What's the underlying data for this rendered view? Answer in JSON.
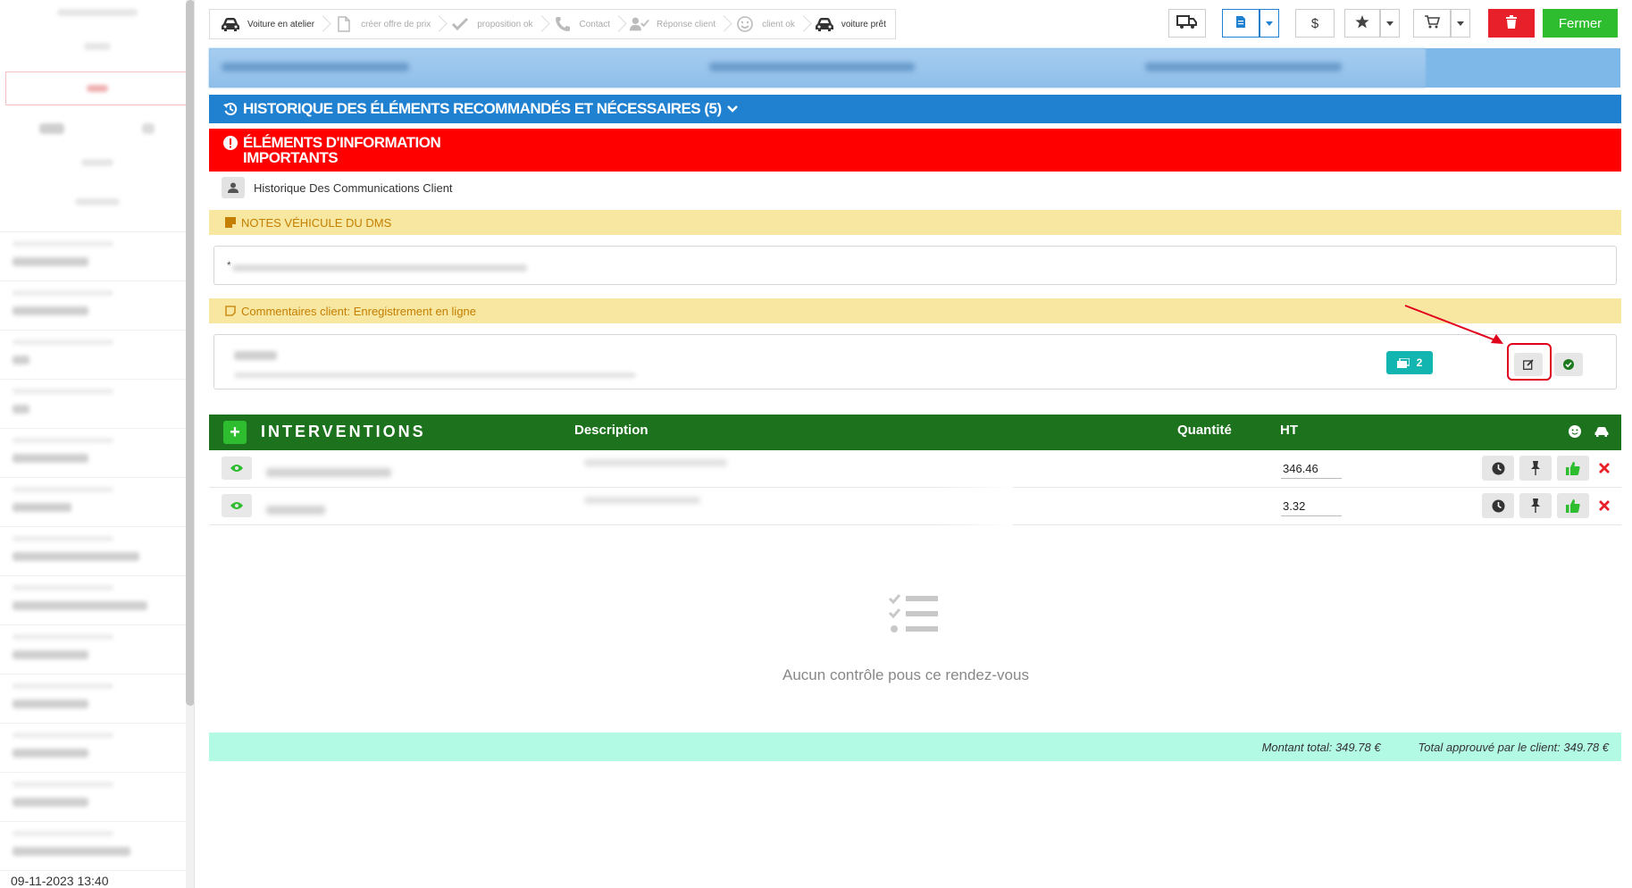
{
  "workflow_steps": [
    {
      "label": "Voiture en atelier",
      "icon": "car-icon",
      "active": true
    },
    {
      "label": "créer offre de prix",
      "icon": "document-icon",
      "active": false
    },
    {
      "label": "proposition ok",
      "icon": "check-icon",
      "active": false
    },
    {
      "label": "Contact",
      "icon": "phone-icon",
      "active": false
    },
    {
      "label": "Réponse client",
      "icon": "user-check-icon",
      "active": false
    },
    {
      "label": "client ok",
      "icon": "smile-icon",
      "active": false
    },
    {
      "label": "voiture prêt",
      "icon": "car-icon",
      "active": true
    }
  ],
  "toolbar": {
    "currency_symbol": "$",
    "close_label": "Fermer"
  },
  "sections": {
    "history_title": "HISTORIQUE DES ÉLÉMENTS RECOMMANDÉS ET NÉCESSAIRES (5)",
    "important_title": "ÉLÉMENTS D'INFORMATION IMPORTANTS",
    "client_comm_history": "Historique Des Communications Client",
    "dms_notes_title": "NOTES VÉHICULE DU DMS",
    "dms_note_bullet": "*",
    "client_comments_title": "Commentaires client: Enregistrement en ligne",
    "image_count": "2"
  },
  "interventions": {
    "title": "INTERVENTIONS",
    "columns": {
      "description": "Description",
      "quantity": "Quantité",
      "ht": "HT"
    },
    "rows": [
      {
        "ht": "346.46"
      },
      {
        "ht": "3.32"
      }
    ]
  },
  "empty_state": {
    "message": "Aucun contrôle pous ce rendez-vous"
  },
  "totals": {
    "total": "Montant total: 349.78 €",
    "approved": "Total approuvé par le client: 349.78 €"
  },
  "sidebar": {
    "footer_timestamp": "09-11-2023 13:40"
  },
  "colors": {
    "blue_bar": "#2181d1",
    "red_bar": "#ff0000",
    "green_header": "#1d721d",
    "close_button": "#2ebd2e",
    "delete_button": "#e8202a",
    "teal_badge": "#13b5b1",
    "totals_bg": "#b2fae4"
  }
}
